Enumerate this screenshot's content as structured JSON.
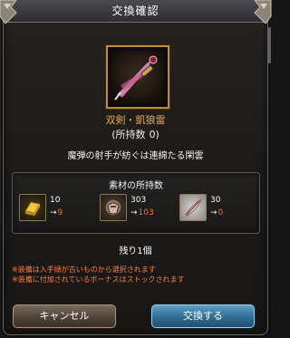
{
  "dialog": {
    "title": "交換確認",
    "item": {
      "name": "双剣・凱狼雷",
      "owned_label": "(所持数",
      "owned_value": "0)",
      "icon": "dual-blade-weapon-icon"
    },
    "description": "魔弾の射手が紡ぐは連綿たる閑雲",
    "materials": {
      "title": "素材の所持数",
      "items": [
        {
          "icon": "gold-brick-icon",
          "count": "10",
          "arrow": "→",
          "after": "9"
        },
        {
          "icon": "armor-fragment-icon",
          "count": "303",
          "arrow": "→",
          "after": "103"
        },
        {
          "icon": "feather-quill-icon",
          "count": "30",
          "arrow": "→",
          "after": "0"
        }
      ]
    },
    "remaining": "残り1個",
    "notes": [
      "※装備は入手順が古いものから選択されます",
      "※装備に付加されているボーナスはストックされます"
    ],
    "buttons": {
      "cancel": "キャンセル",
      "confirm": "交換する"
    }
  }
}
